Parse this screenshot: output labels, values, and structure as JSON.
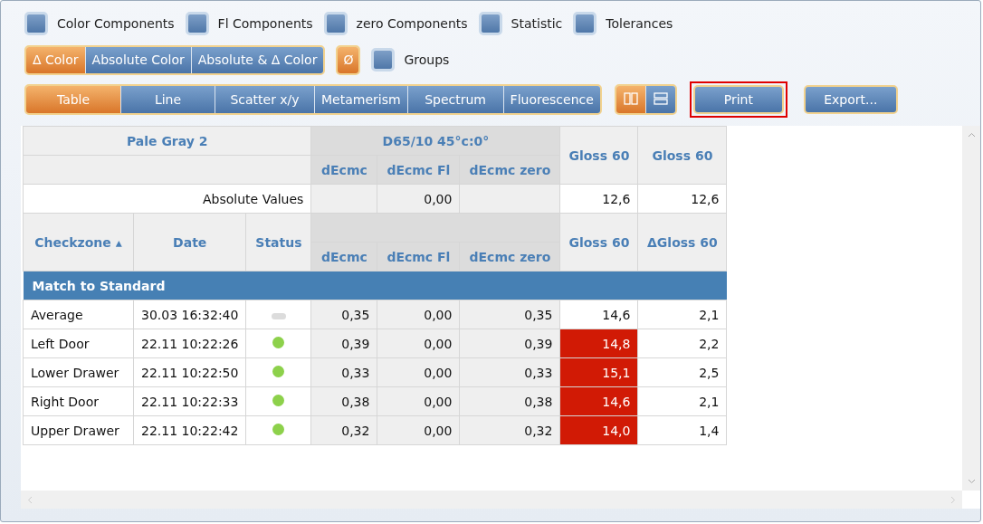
{
  "options": [
    {
      "label": "Color Components",
      "checked": false
    },
    {
      "label": "Fl Components",
      "checked": false
    },
    {
      "label": "zero Components",
      "checked": false
    },
    {
      "label": "Statistic",
      "checked": false
    },
    {
      "label": "Tolerances",
      "checked": false
    }
  ],
  "color_modes": [
    {
      "label": "Δ Color",
      "selected": true
    },
    {
      "label": "Absolute Color",
      "selected": false
    },
    {
      "label": "Absolute & Δ Color",
      "selected": false
    }
  ],
  "average_button": {
    "label": "Ø",
    "on": true
  },
  "groups": {
    "label": "Groups",
    "checked": false
  },
  "views": [
    {
      "label": "Table",
      "selected": true
    },
    {
      "label": "Line",
      "selected": false
    },
    {
      "label": "Scatter x/y",
      "selected": false
    },
    {
      "label": "Metamerism",
      "selected": false
    },
    {
      "label": "Spectrum",
      "selected": false
    },
    {
      "label": "Fluorescence",
      "selected": false
    }
  ],
  "layouts": [
    {
      "kind": "columns",
      "selected": true
    },
    {
      "kind": "rows",
      "selected": false
    }
  ],
  "actions": [
    {
      "label": "Print",
      "highlighted": true
    },
    {
      "label": "Export...",
      "highlighted": false
    }
  ],
  "table": {
    "standard": "Pale Gray 2",
    "illuminant": "D65/10  45°c:0°",
    "metric_columns": [
      "dEcmc",
      "dEcmc Fl",
      "dEcmc zero"
    ],
    "gloss_headers": [
      "Gloss 60",
      "Gloss 60"
    ],
    "absolute_label": "Absolute Values",
    "absolute_fl": "0,00",
    "absolute_gloss": [
      "12,6",
      "12,6"
    ],
    "columns": [
      "Checkzone ▴",
      "Date",
      "Status"
    ],
    "metric_columns_2": [
      "dEcmc",
      "dEcmc Fl",
      "dEcmc zero"
    ],
    "gloss_headers_2": [
      "Gloss 60",
      "ΔGloss 60"
    ],
    "group": "Match to Standard",
    "rows": [
      {
        "name": "Average",
        "date": "30.03 16:32:40",
        "status_ok": false,
        "values": [
          "0,35",
          "0,00",
          "0,35"
        ],
        "gloss": "14,6",
        "gloss_out": false,
        "dgloss": "2,1"
      },
      {
        "name": "Left Door",
        "date": "22.11 10:22:26",
        "status_ok": true,
        "values": [
          "0,39",
          "0,00",
          "0,39"
        ],
        "gloss": "14,8",
        "gloss_out": true,
        "dgloss": "2,2"
      },
      {
        "name": "Lower Drawer",
        "date": "22.11 10:22:50",
        "status_ok": true,
        "values": [
          "0,33",
          "0,00",
          "0,33"
        ],
        "gloss": "15,1",
        "gloss_out": true,
        "dgloss": "2,5"
      },
      {
        "name": "Right Door",
        "date": "22.11 10:22:33",
        "status_ok": true,
        "values": [
          "0,38",
          "0,00",
          "0,38"
        ],
        "gloss": "14,6",
        "gloss_out": true,
        "dgloss": "2,1"
      },
      {
        "name": "Upper Drawer",
        "date": "22.11 10:22:42",
        "status_ok": true,
        "values": [
          "0,32",
          "0,00",
          "0,32"
        ],
        "gloss": "14,0",
        "gloss_out": true,
        "dgloss": "1,4"
      }
    ]
  }
}
